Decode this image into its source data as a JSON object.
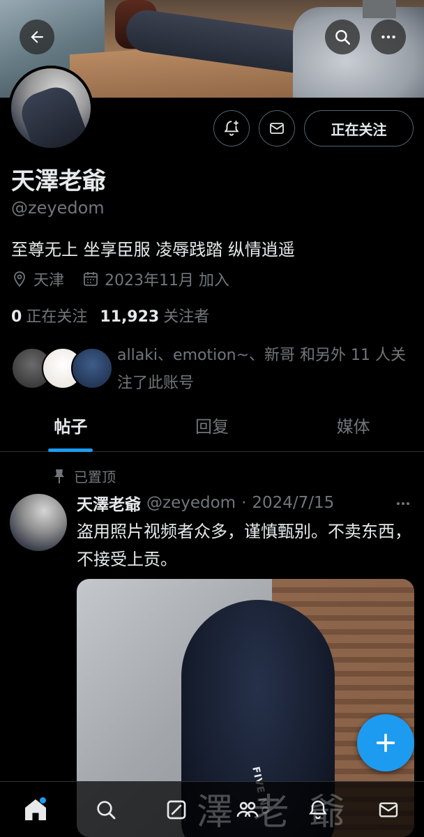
{
  "header": {
    "back_icon": "arrow-left-icon",
    "search_icon": "search-icon",
    "more_icon": "more-horizontal-icon"
  },
  "profile": {
    "name": "天澤老爺",
    "handle": "@zeyedom",
    "bio": "至尊无上 坐享臣服 凌辱践踏 纵情逍遥",
    "location": "天津",
    "joined": "2023年11月 加入",
    "following_count": "0",
    "following_label": "正在关注",
    "followers_count": "11,923",
    "followers_label": "关注者",
    "followed_by_text": "allaki、emotion~、新哥 和另外 11 人关注了此账号"
  },
  "actions": {
    "following_button": "正在关注"
  },
  "tabs": [
    {
      "label": "帖子",
      "active": true
    },
    {
      "label": "回复",
      "active": false
    },
    {
      "label": "媒体",
      "active": false
    }
  ],
  "pinned_post": {
    "pinned_label": "已置顶",
    "author_name": "天澤老爺",
    "author_handle": "@zeyedom",
    "separator": "·",
    "date": "2024/7/15",
    "text": "盗用照片视频者众多，谨慎甄别。不卖东西，不接受上贡。",
    "media_caption": "FIVE NO"
  },
  "watermark": "澤 老 爺",
  "colors": {
    "accent": "#1d9bf0",
    "muted": "#71767b",
    "text": "#e7e9ea",
    "background": "#000000"
  },
  "bottom_nav": [
    "home-icon",
    "search-icon",
    "grok-icon",
    "communities-icon",
    "notifications-icon",
    "messages-icon"
  ]
}
